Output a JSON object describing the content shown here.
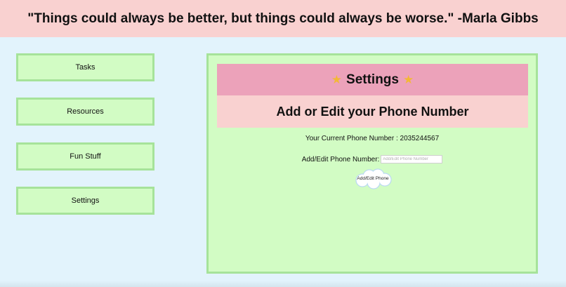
{
  "banner": {
    "quote": "\"Things could always be better, but things could always be worse.\" -Marla Gibbs"
  },
  "nav": {
    "items": [
      {
        "label": "Tasks"
      },
      {
        "label": "Resources"
      },
      {
        "label": "Fun Stuff"
      },
      {
        "label": "Settings"
      }
    ]
  },
  "panel": {
    "title": "Settings",
    "title_icon": "star-icon",
    "subtitle": "Add or Edit your Phone Number",
    "current_phone_text": "Your Current Phone Number : 2035244567",
    "field_label": "Add/Edit Phone Number:",
    "field_placeholder": "Add/Edit Phone Number",
    "field_value": "",
    "submit_label": "Add/Edit Phone"
  },
  "colors": {
    "background": "#e2f3fc",
    "banner": "#f9d1d0",
    "nav_fill": "#d2fcc4",
    "nav_border": "#a6e39a",
    "title_bar": "#eca2ba",
    "subtitle_bar": "#f9d1d0"
  }
}
